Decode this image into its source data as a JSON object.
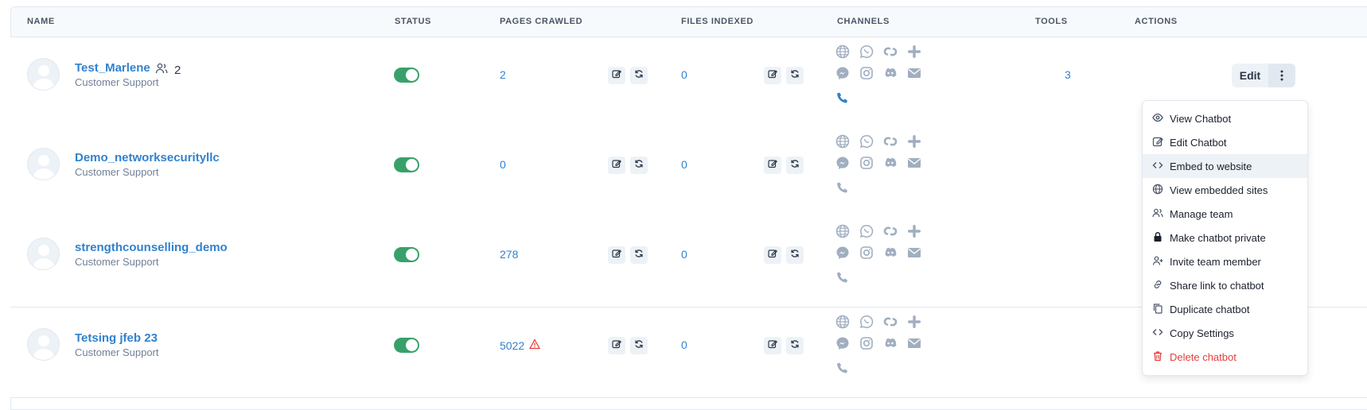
{
  "headers": {
    "name": "NAME",
    "status": "STATUS",
    "pages_crawled": "PAGES CRAWLED",
    "files_indexed": "FILES INDEXED",
    "channels": "CHANNELS",
    "tools": "TOOLS",
    "actions": "ACTIONS"
  },
  "rows": [
    {
      "name": "Test_Marlene",
      "team_count": "2",
      "role": "Customer Support",
      "status_on": true,
      "pages": "2",
      "pages_warning": false,
      "files": "0",
      "tools": "3",
      "phone_active": true
    },
    {
      "name": "Demo_networksecurityllc",
      "role": "Customer Support",
      "status_on": true,
      "pages": "0",
      "pages_warning": false,
      "files": "0",
      "phone_active": false
    },
    {
      "name": "strengthcounselling_demo",
      "role": "Customer Support",
      "status_on": true,
      "pages": "278",
      "pages_warning": false,
      "files": "0",
      "phone_active": false
    },
    {
      "name": "Tetsing jfeb 23",
      "role": "Customer Support",
      "status_on": true,
      "pages": "5022",
      "pages_warning": true,
      "files": "0",
      "phone_active": false
    }
  ],
  "actions": {
    "edit_label": "Edit"
  },
  "menu": {
    "items": [
      {
        "label": "View Chatbot",
        "icon": "eye-icon"
      },
      {
        "label": "Edit Chatbot",
        "icon": "edit-icon"
      },
      {
        "label": "Embed to website",
        "icon": "code-icon",
        "active": true
      },
      {
        "label": "View embedded sites",
        "icon": "globe-icon"
      },
      {
        "label": "Manage team",
        "icon": "users-icon"
      },
      {
        "label": "Make chatbot private",
        "icon": "lock-icon"
      },
      {
        "label": "Invite team member",
        "icon": "user-plus-icon"
      },
      {
        "label": "Share link to chatbot",
        "icon": "link-icon"
      },
      {
        "label": "Duplicate chatbot",
        "icon": "copy-icon"
      },
      {
        "label": "Copy Settings",
        "icon": "code-icon"
      },
      {
        "label": "Delete chatbot",
        "icon": "trash-icon",
        "danger": true
      }
    ]
  },
  "colors": {
    "link": "#3182ce",
    "toggle_on": "#38a169",
    "danger": "#e53e3e",
    "channel_icon": "#a0aec0",
    "phone_active": "#3182ce"
  }
}
